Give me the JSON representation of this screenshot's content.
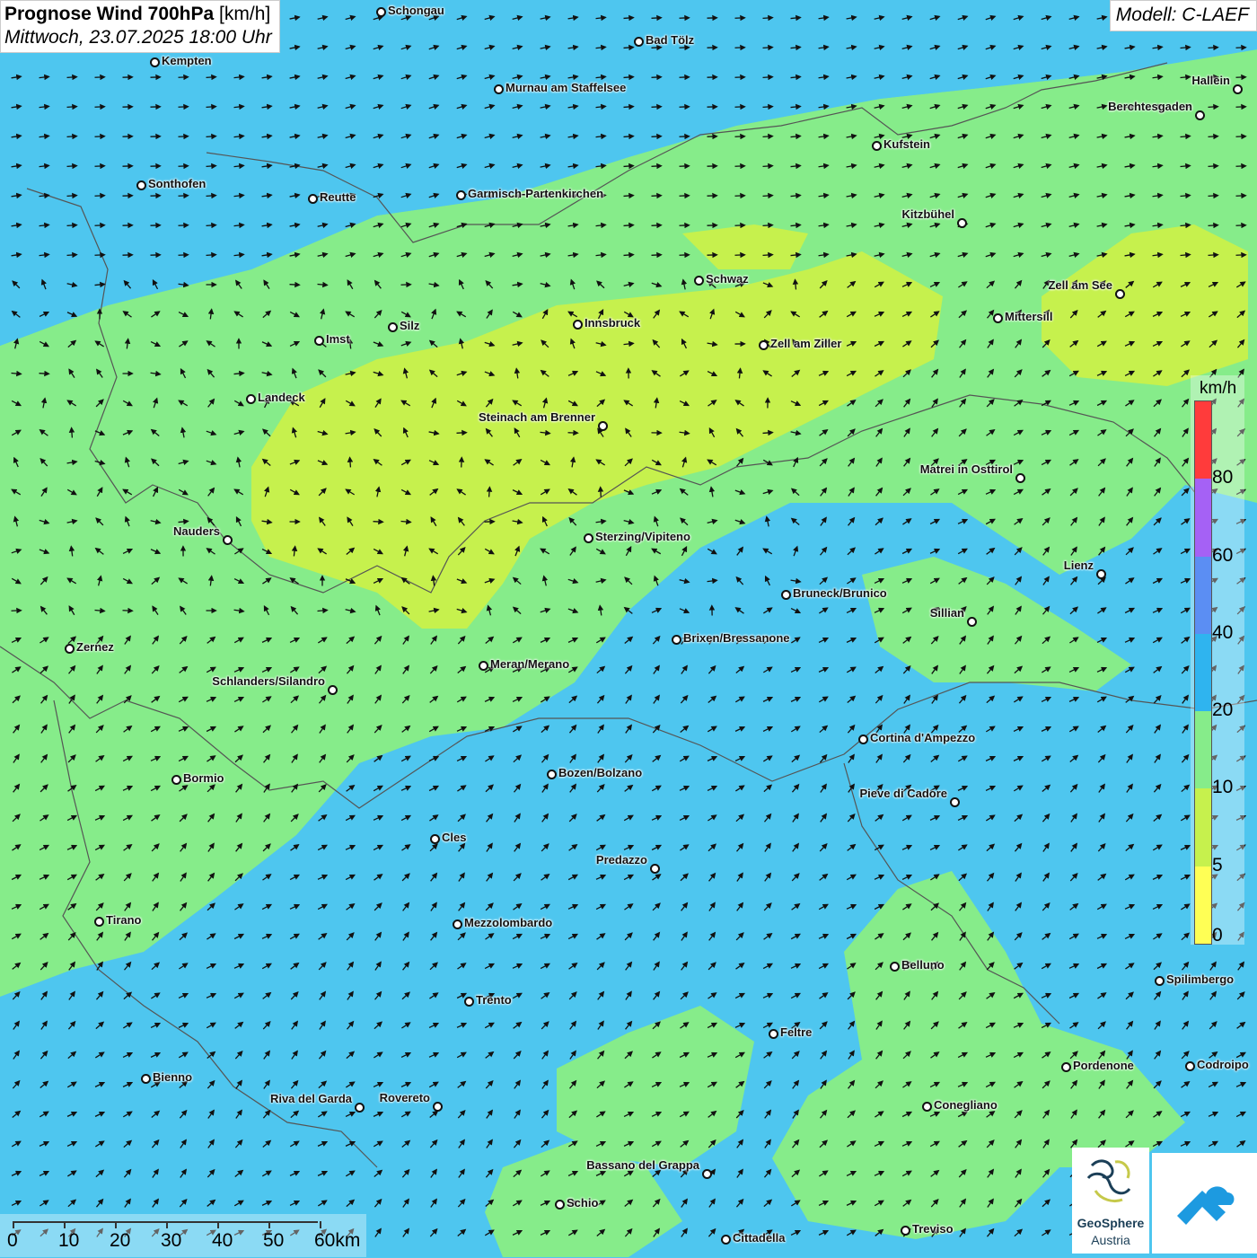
{
  "title": {
    "bold": "Prognose Wind 700hPa",
    "unit": " [km/h]",
    "date": "Mittwoch, 23.07.2025 18:00 Uhr"
  },
  "model": "Modell: C-LAEF",
  "legend": {
    "unit": "km/h",
    "ticks": [
      "80",
      "60",
      "40",
      "20",
      "10",
      "5",
      "0"
    ],
    "colors": [
      "#ff3b3b",
      "#a561f5",
      "#5b8ef3",
      "#2fb4ef",
      "#86ec8a",
      "#c6f14d",
      "#ffff55"
    ]
  },
  "scale": {
    "labels": [
      "0",
      "10",
      "20",
      "30",
      "40",
      "50",
      "60km"
    ]
  },
  "logos": {
    "geosphere_line1": "GeoSphere",
    "geosphere_line2": "Austria"
  },
  "cities": [
    {
      "name": "Schongau"
    },
    {
      "name": "Bad Tölz"
    },
    {
      "name": "Kempten"
    },
    {
      "name": "Murnau am Staffelsee"
    },
    {
      "name": "Hallein"
    },
    {
      "name": "Berchtesgaden"
    },
    {
      "name": "Kufstein"
    },
    {
      "name": "Sonthofen"
    },
    {
      "name": "Reutte"
    },
    {
      "name": "Garmisch-Partenkirchen"
    },
    {
      "name": "Kitzbühel"
    },
    {
      "name": "Schwaz"
    },
    {
      "name": "Zell am See"
    },
    {
      "name": "Mittersill"
    },
    {
      "name": "Innsbruck"
    },
    {
      "name": "Silz"
    },
    {
      "name": "Imst"
    },
    {
      "name": "Zell am Ziller"
    },
    {
      "name": "Landeck"
    },
    {
      "name": "Steinach am Brenner"
    },
    {
      "name": "Matrei in Osttirol"
    },
    {
      "name": "Nauders"
    },
    {
      "name": "Sterzing/Vipiteno"
    },
    {
      "name": "Lienz"
    },
    {
      "name": "Bruneck/Brunico"
    },
    {
      "name": "Sillian"
    },
    {
      "name": "Brixen/Bressanone"
    },
    {
      "name": "Zernez"
    },
    {
      "name": "Meran/Merano"
    },
    {
      "name": "Schlanders/Silandro"
    },
    {
      "name": "Cortina d'Ampezzo"
    },
    {
      "name": "Bozen/Bolzano"
    },
    {
      "name": "Bormio"
    },
    {
      "name": "Pieve di Cadore"
    },
    {
      "name": "Cles"
    },
    {
      "name": "Predazzo"
    },
    {
      "name": "Tirano"
    },
    {
      "name": "Mezzolombardo"
    },
    {
      "name": "Belluno"
    },
    {
      "name": "Spilimbergo"
    },
    {
      "name": "Trento"
    },
    {
      "name": "Feltre"
    },
    {
      "name": "Pordenone"
    },
    {
      "name": "Codroipo"
    },
    {
      "name": "Bienno"
    },
    {
      "name": "Riva del Garda"
    },
    {
      "name": "Rovereto"
    },
    {
      "name": "Conegliano"
    },
    {
      "name": "Bassano del Grappa"
    },
    {
      "name": "Schio"
    },
    {
      "name": "Treviso"
    },
    {
      "name": "Cittadella"
    }
  ]
}
